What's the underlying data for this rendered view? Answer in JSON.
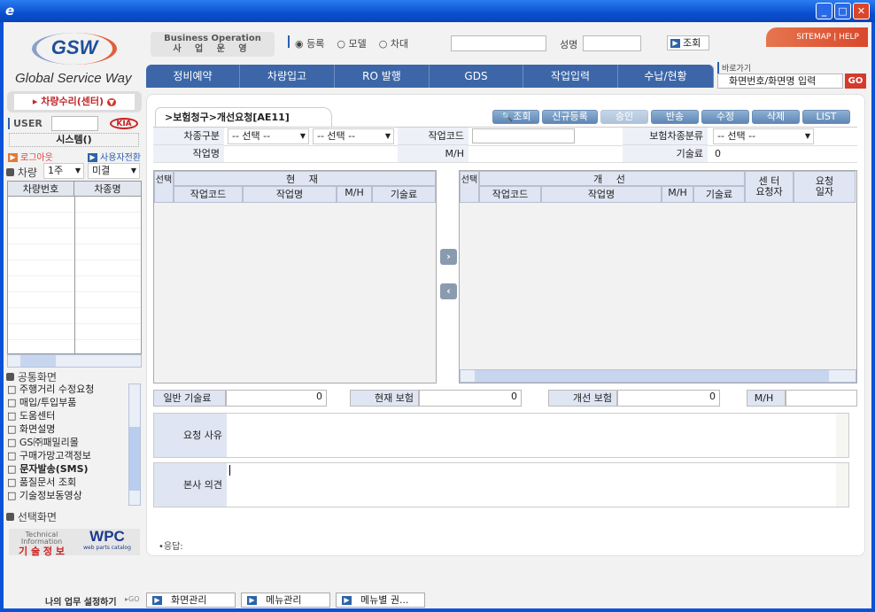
{
  "window": {
    "icon": "ie-icon",
    "minimize": "_",
    "maximize": "□",
    "close": "✕"
  },
  "header": {
    "logo_text": "GSW",
    "logo_tagline": "Global Service Way",
    "business_en": "Business Operation",
    "business_ko": "사 업 운 영",
    "radios": [
      {
        "label": "등록",
        "checked": true
      },
      {
        "label": "모델",
        "checked": false
      },
      {
        "label": "차대",
        "checked": false
      }
    ],
    "name_label": "성명",
    "search_button": "조회",
    "sitemap": "SITEMAP",
    "help": "HELP",
    "shortcut_label": "바로가기",
    "shortcut_placeholder": "화면번호/화면명 입력",
    "go": "GO",
    "tabs": [
      "정비예약",
      "차량입고",
      "RO 발행",
      "GDS",
      "작업입력",
      "수납/현황"
    ]
  },
  "sidebar": {
    "module": "차량수리(센터)",
    "user_label": "USER",
    "brand": "KIA",
    "system": "시스템()",
    "logout": "로그아웃",
    "switch_user": "사용자전환",
    "vehicle_label": "차량",
    "week": "1주",
    "status": "미결",
    "columns": [
      "차량번호",
      "차종명"
    ],
    "common_title": "공통화면",
    "common_items": [
      "주행거리 수정요청",
      "매입/투입부품",
      "도움센터",
      "화면설명",
      "GS㈜패밀리몰",
      "구매가망고객정보",
      "문자발송(SMS)",
      "품질문서 조회",
      "기술정보동영상"
    ],
    "select_title": "선택화면",
    "tech_info_en": "Technical Information",
    "tech_info_ko": "기 술 정 보",
    "wpc": "WPC",
    "wpc_sub": "web parts catalog"
  },
  "main": {
    "breadcrumb": ">보험청구>개선요청[AE11]",
    "toolbar": [
      "조회",
      "신규등록",
      "승인",
      "반송",
      "수정",
      "삭제",
      "LIST"
    ],
    "form": {
      "car_type_label": "차종구분",
      "car_type_1": "-- 선택 --",
      "car_type_2": "-- 선택 --",
      "work_code_label": "작업코드",
      "work_code": "",
      "ins_class_label": "보험차종분류",
      "ins_class": "-- 선택 --",
      "work_name_label": "작업명",
      "work_name": "",
      "mh_label": "M/H",
      "mh": "",
      "tech_fee_label": "기술료",
      "tech_fee": "0"
    },
    "current_table": {
      "select": "선택",
      "group": "현 재",
      "columns": [
        "작업코드",
        "작업명",
        "M/H",
        "기술료"
      ]
    },
    "improved_table": {
      "select": "선택",
      "group": "개 선",
      "columns": [
        "작업코드",
        "작업명",
        "M/H",
        "기술료",
        "센 터 요청자",
        "요청 일자"
      ]
    },
    "totals": {
      "general_fee_label": "일반 기술료",
      "general_fee": "0",
      "current_ins_label": "현재 보험",
      "current_ins": "0",
      "improved_ins_label": "개선 보험",
      "improved_ins": "0",
      "mh_label": "M/H",
      "mh": ""
    },
    "reason_label": "요청 사유",
    "hq_opinion_label": "본사 의견",
    "reply_label": "•응답:"
  },
  "footer": {
    "my_settings": "나의 업무 설정하기",
    "go": "▸GO",
    "buttons": [
      "화면관리",
      "메뉴관리",
      "메뉴별 권..."
    ]
  }
}
